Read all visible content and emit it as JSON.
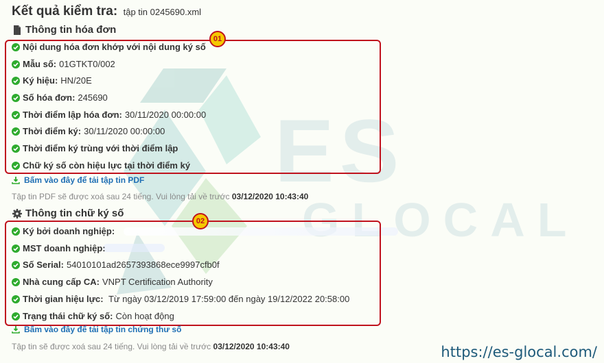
{
  "header": {
    "title": "Kết quả kiểm tra:",
    "file_label": "tập tin 0245690.xml"
  },
  "invoice_section": {
    "title": "Thông tin hóa đơn",
    "badge": "01",
    "rows": [
      {
        "label": "Nội dung hóa đơn khớp với nội dung ký số",
        "value": ""
      },
      {
        "label": "Mẫu số:",
        "value": "01GTKT0/002"
      },
      {
        "label": "Ký hiệu:",
        "value": "HN/20E"
      },
      {
        "label": "Số hóa đơn:",
        "value": "245690"
      },
      {
        "label": "Thời điểm lập hóa đơn:",
        "value": "30/11/2020 00:00:00"
      },
      {
        "label": "Thời điểm ký:",
        "value": "30/11/2020 00:00:00"
      },
      {
        "label": "Thời điểm ký trùng với thời điểm lập",
        "value": ""
      },
      {
        "label": "Chữ ký số còn hiệu lực tại thời điểm ký",
        "value": ""
      }
    ],
    "download_label": "Bấm vào đây để tải tập tin PDF",
    "note_text": "Tập tin PDF sẽ được xoá sau 24 tiếng. Vui lòng tải về trước",
    "note_deadline": "03/12/2020 10:43:40"
  },
  "signature_section": {
    "title": "Thông tin chữ ký số",
    "badge": "02",
    "rows": [
      {
        "label": "Ký bởi doanh nghiệp:",
        "value": ""
      },
      {
        "label": "MST doanh nghiệp:",
        "value": ""
      },
      {
        "label": "Số Serial:",
        "value": "54010101ad2657393868ece9997cfb0f"
      },
      {
        "label": "Nhà cung cấp CA:",
        "value": "VNPT Certification Authority"
      },
      {
        "label": "Thời gian hiệu lực:",
        "value": " Từ ngày 03/12/2019 17:59:00 đến ngày 19/12/2022 20:58:00"
      },
      {
        "label": "Trạng thái chữ ký số:",
        "value": "Còn hoạt động"
      }
    ],
    "download_label": "Bấm vào đây để tải tập tin chứng thư số",
    "note_text": "Tập tin sẽ được xoá sau 24 tiếng. Vui lòng tải về trước",
    "note_deadline": "03/12/2020 10:43:40"
  },
  "watermark": {
    "text_main": "ES",
    "text_sub": "GLOCAL"
  },
  "footer": {
    "url": "https://es-glocal.com/"
  },
  "colors": {
    "check": "#2eab2e",
    "highlight": "#c0121d",
    "badge": "#f5c800",
    "link": "#1f6fb4",
    "note": "#8a8a8a"
  }
}
